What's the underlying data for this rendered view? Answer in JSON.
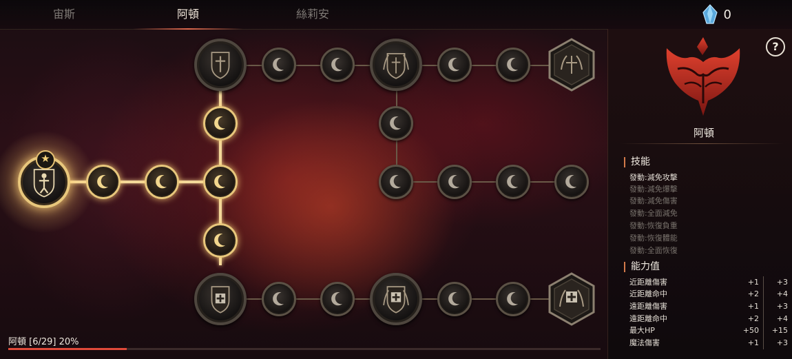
{
  "tabs": [
    {
      "label": "宙斯",
      "active": false
    },
    {
      "label": "阿頓",
      "active": true
    },
    {
      "label": "絲莉安",
      "active": false
    }
  ],
  "currency": {
    "icon": "crystal-icon",
    "value": "0",
    "color": "#7ec8f0"
  },
  "panel": {
    "class_name": "阿頓",
    "help_label": "?",
    "skills_title": "技能",
    "skills": [
      {
        "label": "發動:減免攻擊",
        "active": true
      },
      {
        "label": "發動:減免爆擊",
        "active": false
      },
      {
        "label": "發動:減免傷害",
        "active": false
      },
      {
        "label": "發動:全面減免",
        "active": false
      },
      {
        "label": "發動:恢復負重",
        "active": false
      },
      {
        "label": "發動:恢復體能",
        "active": false
      },
      {
        "label": "發動:全面恢復",
        "active": false
      }
    ],
    "stats_title": "能力值",
    "stats": [
      {
        "name": "近距離傷害",
        "current": "+1",
        "max": "+3"
      },
      {
        "name": "近距離命中",
        "current": "+2",
        "max": "+4"
      },
      {
        "name": "遠距離傷害",
        "current": "+1",
        "max": "+3"
      },
      {
        "name": "遠距離命中",
        "current": "+2",
        "max": "+4"
      },
      {
        "name": "最大HP",
        "current": "+50",
        "max": "+15"
      },
      {
        "name": "魔法傷害",
        "current": "+1",
        "max": "+3"
      }
    ]
  },
  "progress": {
    "label": "阿頓 [6/29] 20%",
    "fraction": 0.2
  },
  "colors": {
    "accent_gold": "#e8c77c",
    "accent_red": "#e04a3a",
    "emblem_red": "#c0291f"
  }
}
